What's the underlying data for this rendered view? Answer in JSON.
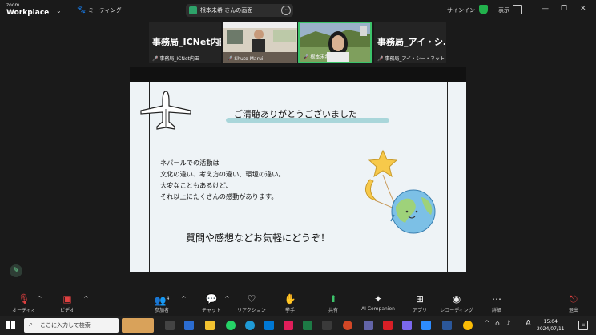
{
  "app": {
    "logo_top": "zoom",
    "logo_bottom": "Workplace",
    "meeting_label": "ミーティング",
    "share_title": "根本未希 さんの画面",
    "signin": "サインイン",
    "view": "表示"
  },
  "participants": [
    {
      "name": "事務局_ICNet内田",
      "label": "事務局_ICNet内田"
    },
    {
      "name": "",
      "label": "Shuto Marui"
    },
    {
      "name": "",
      "label": "根本未希"
    },
    {
      "name": "事務局_アイ・シ…",
      "label": "事務局_アイ・シー・ネット"
    }
  ],
  "slide": {
    "title": "ご清聴ありがとうございました",
    "body": [
      "ネパールでの活動は",
      "文化の違い、考え方の違い、環境の違い。",
      "大変なこともあるけど、",
      "それ以上にたくさんの感動があります。"
    ],
    "closing": "質問や感想などお気軽にどうぞ！"
  },
  "toolbar": {
    "audio": "オーディオ",
    "video": "ビデオ",
    "participants": "参加者",
    "participants_count": "4",
    "chat": "チャット",
    "reactions": "リアクション",
    "raise_hand": "挙手",
    "share": "共有",
    "ai": "AI Companion",
    "apps": "アプリ",
    "record": "レコーディング",
    "more": "詳細",
    "leave": "退出"
  },
  "taskbar": {
    "search_placeholder": "ここに入力して検索",
    "time": "15:04",
    "date": "2024/07/11"
  },
  "colors": {
    "accent_green": "#22b14c",
    "slide_bg": "#eef3f6",
    "title_highlight": "#a9d6da",
    "active_speaker": "#3cc36a"
  }
}
